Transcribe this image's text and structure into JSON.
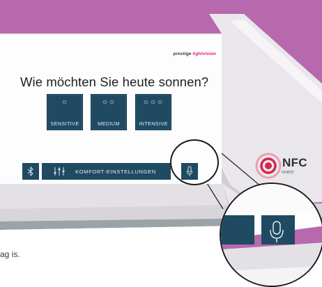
{
  "brand": {
    "prefix": "prestige",
    "accent": "lightvision"
  },
  "question": "Wie möchten Sie heute sonnen?",
  "intensity_buttons": [
    {
      "label": "SENSITIVE",
      "suns": "☼"
    },
    {
      "label": "MEDIUM",
      "suns": "☼☼"
    },
    {
      "label": "INTENSIVE",
      "suns": "☼☼☼"
    }
  ],
  "bottom_bar": {
    "bluetooth_icon": "bluetooth-icon",
    "komfort_label": "KOMFORT-EINSTELLUNGEN",
    "sliders_icon": "sliders-icon",
    "mic_icon": "microphone-icon"
  },
  "nfc": {
    "label": "NFC",
    "sub": "nnect"
  },
  "caption": "ag is.",
  "colors": {
    "button_blue": "#1f4a62",
    "purple_bg": "#b46aaa",
    "nfc_red": "#d4284b",
    "brand_pink": "#e61b7c"
  }
}
